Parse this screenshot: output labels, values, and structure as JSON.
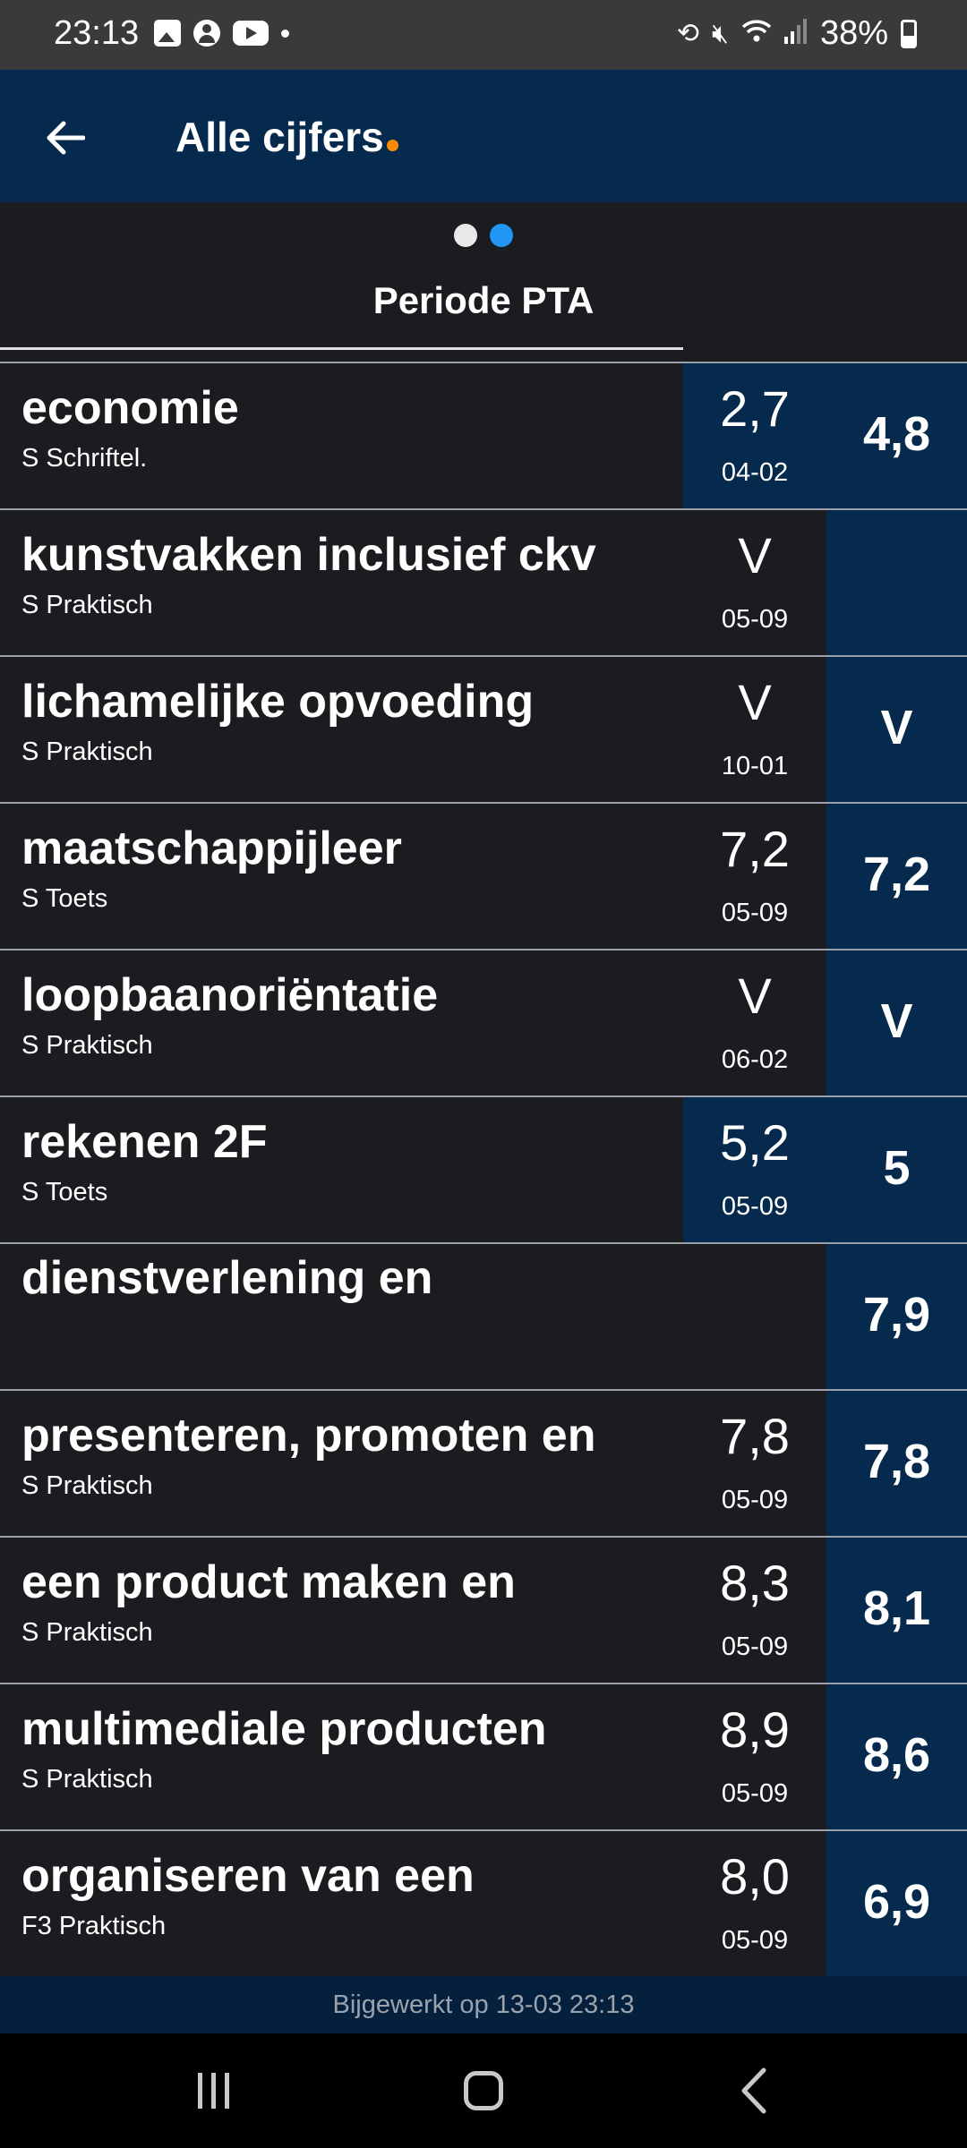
{
  "status_bar": {
    "time": "23:13",
    "battery": "38%",
    "left_icons": [
      "image-icon",
      "account-icon",
      "youtube-icon",
      "dot-icon"
    ],
    "right_icons": [
      "sync-icon",
      "mute-icon",
      "wifi-icon",
      "signal-icon",
      "battery-icon"
    ]
  },
  "appbar": {
    "title": "Alle cijfers",
    "accent_color": "#ff8a00",
    "back_icon": "arrow-left-icon"
  },
  "period": {
    "label": "Periode PTA",
    "pages": 2,
    "active_page": 2
  },
  "rows": [
    {
      "subject": "economie",
      "type": "S Schriftel.",
      "grade": "2,7",
      "date": "04-02",
      "average": "4,8",
      "grade_highlight": true
    },
    {
      "subject": "kunstvakken inclusief ckv",
      "type": "S Praktisch",
      "grade": "V",
      "date": "05-09",
      "average": "",
      "grade_highlight": false
    },
    {
      "subject": "lichamelijke opvoeding",
      "type": "S Praktisch",
      "grade": "V",
      "date": "10-01",
      "average": "V",
      "grade_highlight": false
    },
    {
      "subject": "maatschappijleer",
      "type": "S Toets",
      "grade": "7,2",
      "date": "05-09",
      "average": "7,2",
      "grade_highlight": false
    },
    {
      "subject": "loopbaanoriëntatie",
      "type": "S Praktisch",
      "grade": "V",
      "date": "06-02",
      "average": "V",
      "grade_highlight": false
    },
    {
      "subject": "rekenen 2F",
      "type": "S Toets",
      "grade": "5,2",
      "date": "05-09",
      "average": "5",
      "grade_highlight": true
    },
    {
      "subject": "dienstverlening en",
      "type": "",
      "grade": "",
      "date": "",
      "average": "7,9",
      "grade_highlight": false
    },
    {
      "subject": "presenteren, promoten en",
      "type": "S Praktisch",
      "grade": "7,8",
      "date": "05-09",
      "average": "7,8",
      "grade_highlight": false
    },
    {
      "subject": "een product maken en",
      "type": "S Praktisch",
      "grade": "8,3",
      "date": "05-09",
      "average": "8,1",
      "grade_highlight": false
    },
    {
      "subject": "multimediale producten",
      "type": "S Praktisch",
      "grade": "8,9",
      "date": "05-09",
      "average": "8,6",
      "grade_highlight": false
    },
    {
      "subject": "organiseren van een",
      "type": "F3 Praktisch",
      "grade": "8,0",
      "date": "05-09",
      "average": "6,9",
      "grade_highlight": false
    }
  ],
  "footer": {
    "updated": "Bijgewerkt op 13-03 23:13"
  },
  "navbar": {
    "recents_icon": "recents-icon",
    "home_icon": "home-icon",
    "back_icon": "back-chevron-icon"
  }
}
